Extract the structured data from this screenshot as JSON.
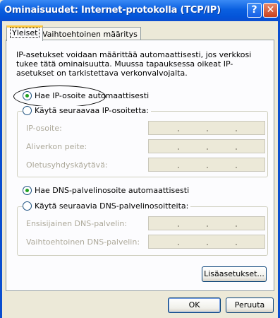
{
  "window": {
    "title": "Ominaisuudet: Internet-protokolla (TCP/IP)",
    "help_glyph": "?",
    "close_glyph": "✕"
  },
  "tabs": [
    {
      "label": "Yleiset",
      "active": true
    },
    {
      "label": "Vaihtoehtoinen määritys",
      "active": false
    }
  ],
  "description": "IP-asetukset voidaan määrittää automaattisesti, jos verkkosi tukee tätä ominaisuutta. Muussa tapauksessa oikeat IP-asetukset on tarkistettava verkonvalvojalta.",
  "ip_options": {
    "auto": {
      "label": "Hae IP-osoite automaattisesti",
      "checked": true
    },
    "manual": {
      "label": "Käytä seuraavaa IP-osoitetta:",
      "checked": false
    }
  },
  "ip_fields": [
    {
      "label": "IP-osoite:",
      "value": "",
      "enabled": false
    },
    {
      "label": "Aliverkon peite:",
      "value": "",
      "enabled": false
    },
    {
      "label": "Oletusyhdyskäytävä:",
      "value": "",
      "enabled": false
    }
  ],
  "dns_options": {
    "auto": {
      "label": "Hae DNS-palvelinosoite automaattisesti",
      "checked": true
    },
    "manual": {
      "label": "Käytä seuraavia DNS-palvelinosoitteita:",
      "checked": false
    }
  },
  "dns_fields": [
    {
      "label": "Ensisijainen DNS-palvelin:",
      "value": "",
      "enabled": false
    },
    {
      "label": "Vaihtoehtoinen DNS-palvelin:",
      "value": "",
      "enabled": false
    }
  ],
  "buttons": {
    "advanced": "Lisäasetukset...",
    "ok": "OK",
    "cancel": "Peruuta"
  },
  "colors": {
    "titlebar": "#0a5fe0",
    "radio_dot": "#21a121",
    "disabled_text": "#aca899",
    "active_tab_highlight": "#ffc83c"
  }
}
